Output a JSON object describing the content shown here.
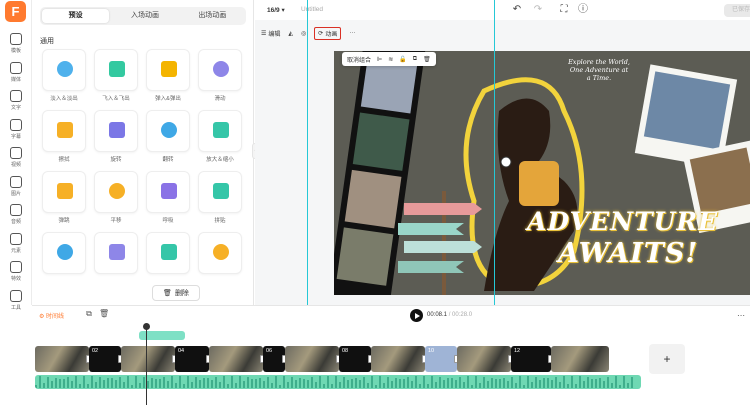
{
  "app": {
    "logo_letter": "F"
  },
  "rail": [
    {
      "label": "模板",
      "icon": "template-icon"
    },
    {
      "label": "媒体",
      "icon": "media-icon"
    },
    {
      "label": "文字",
      "icon": "text-icon"
    },
    {
      "label": "字幕",
      "icon": "subtitle-icon"
    },
    {
      "label": "视频",
      "icon": "video-icon"
    },
    {
      "label": "图片",
      "icon": "image-icon"
    },
    {
      "label": "音频",
      "icon": "audio-icon"
    },
    {
      "label": "元素",
      "icon": "element-icon"
    },
    {
      "label": "特效",
      "icon": "effect-icon"
    },
    {
      "label": "工具",
      "icon": "tool-icon"
    }
  ],
  "panel": {
    "tabs": [
      "预设",
      "入场动画",
      "出场动画"
    ],
    "active_tab": "预设",
    "section_title": "通用",
    "effects": [
      {
        "label": "淡入＆淡出",
        "color": "#4fb1ec"
      },
      {
        "label": "飞入＆飞出",
        "color": "#33c9a0"
      },
      {
        "label": "弹入&弹出",
        "color": "#f4b400"
      },
      {
        "label": "滑动",
        "color": "#8e86e8"
      },
      {
        "label": "擦拭",
        "color": "#f6b026"
      },
      {
        "label": "旋转",
        "color": "#7b77e6"
      },
      {
        "label": "翻转",
        "color": "#3fa8e6"
      },
      {
        "label": "放大＆缩小",
        "color": "#35c6a8"
      },
      {
        "label": "弹跳",
        "color": "#f6b026"
      },
      {
        "label": "平移",
        "color": "#f6b026"
      },
      {
        "label": "呼吸",
        "color": "#8a72e6"
      },
      {
        "label": "拼贴",
        "color": "#35c6a8"
      },
      {
        "label": "",
        "color": "#3fa8e6"
      },
      {
        "label": "",
        "color": "#8e86e8"
      },
      {
        "label": "",
        "color": "#35c6a8"
      },
      {
        "label": "",
        "color": "#f6b026"
      }
    ],
    "delete_label": "删除"
  },
  "topbar": {
    "ratio": "16/9",
    "doc_title": "Untitled",
    "export_label": "已保存"
  },
  "edit_bar": {
    "edit_label": "编辑",
    "animation_label": "动画",
    "more": "···"
  },
  "float_bar": {
    "ungroup_label": "取消组合"
  },
  "artboard": {
    "script_text": "Explore the World,\nOne Adventure at\na Time.",
    "headline_1": "ADVENTURE",
    "headline_2": "AWAITS!"
  },
  "timeline": {
    "label": "时间线",
    "current_time": "00:08.1",
    "total_time": "00:28.0",
    "clips": [
      {
        "type": "photo",
        "label": ""
      },
      {
        "type": "black",
        "label": "02"
      },
      {
        "type": "photo",
        "label": ""
      },
      {
        "type": "black",
        "label": "04"
      },
      {
        "type": "photo",
        "label": ""
      },
      {
        "type": "black",
        "label": "06"
      },
      {
        "type": "photo",
        "label": ""
      },
      {
        "type": "black",
        "label": "08"
      },
      {
        "type": "photo",
        "label": ""
      },
      {
        "type": "blue",
        "label": "10"
      },
      {
        "type": "photo",
        "label": ""
      },
      {
        "type": "black",
        "label": "12"
      },
      {
        "type": "photo",
        "label": ""
      }
    ],
    "add_label": "+"
  }
}
